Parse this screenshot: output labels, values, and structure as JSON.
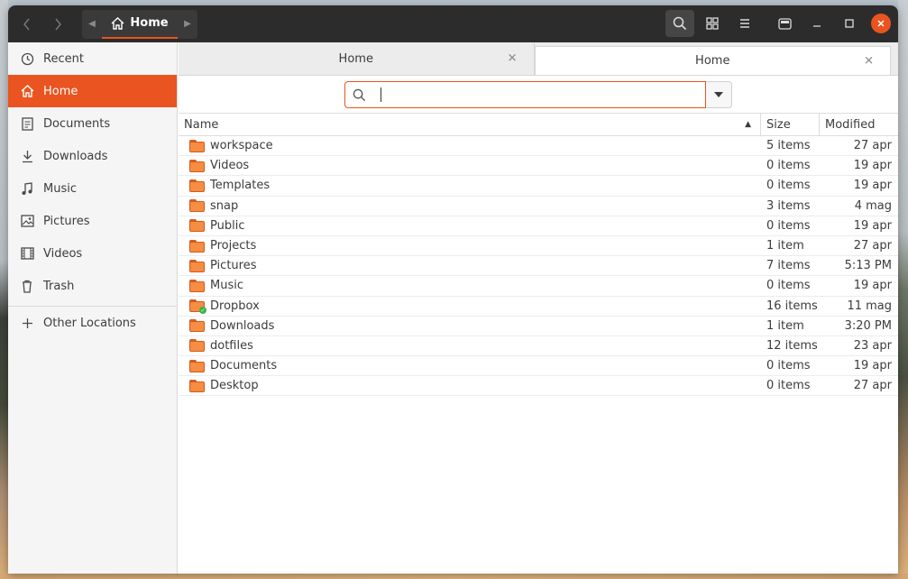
{
  "header": {
    "back_icon": "chevron-left-icon",
    "forward_icon": "chevron-right-icon",
    "path_label": "Home",
    "search_icon": "search-icon",
    "grid_icon": "grid-view-icon",
    "menu_icon": "hamburger-menu-icon"
  },
  "sidebar": {
    "items": [
      {
        "label": "Recent",
        "icon": "clock-icon"
      },
      {
        "label": "Home",
        "icon": "home-icon",
        "selected": true
      },
      {
        "label": "Documents",
        "icon": "document-icon"
      },
      {
        "label": "Downloads",
        "icon": "download-icon"
      },
      {
        "label": "Music",
        "icon": "music-icon"
      },
      {
        "label": "Pictures",
        "icon": "picture-icon"
      },
      {
        "label": "Videos",
        "icon": "video-icon"
      },
      {
        "label": "Trash",
        "icon": "trash-icon"
      },
      {
        "label": "Other Locations",
        "icon": "plus-icon"
      }
    ]
  },
  "tabs": [
    {
      "label": "Home",
      "active": false
    },
    {
      "label": "Home",
      "active": true
    }
  ],
  "search": {
    "value": ""
  },
  "columns": {
    "name": "Name",
    "size": "Size",
    "modified": "Modified"
  },
  "files": [
    {
      "name": "workspace",
      "size": "5 items",
      "modified": "27 apr"
    },
    {
      "name": "Videos",
      "size": "0 items",
      "modified": "19 apr"
    },
    {
      "name": "Templates",
      "size": "0 items",
      "modified": "19 apr"
    },
    {
      "name": "snap",
      "size": "3 items",
      "modified": "4 mag"
    },
    {
      "name": "Public",
      "size": "0 items",
      "modified": "19 apr"
    },
    {
      "name": "Projects",
      "size": "1 item",
      "modified": "27 apr"
    },
    {
      "name": "Pictures",
      "size": "7 items",
      "modified": "5:13 PM"
    },
    {
      "name": "Music",
      "size": "0 items",
      "modified": "19 apr"
    },
    {
      "name": "Dropbox",
      "size": "16 items",
      "modified": "11 mag",
      "synced": true
    },
    {
      "name": "Downloads",
      "size": "1 item",
      "modified": "3:20 PM"
    },
    {
      "name": "dotfiles",
      "size": "12 items",
      "modified": "23 apr"
    },
    {
      "name": "Documents",
      "size": "0 items",
      "modified": "19 apr"
    },
    {
      "name": "Desktop",
      "size": "0 items",
      "modified": "27 apr"
    }
  ],
  "colors": {
    "accent": "#e95420",
    "headerbar": "#2c2c2c",
    "folder": "#f58d42"
  }
}
